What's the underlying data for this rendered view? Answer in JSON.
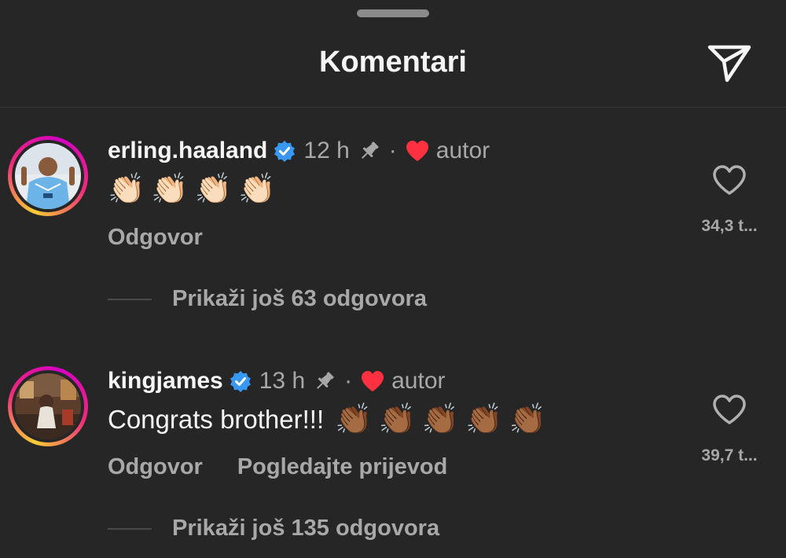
{
  "header": {
    "title": "Komentari",
    "share_icon": "send-icon"
  },
  "comments": [
    {
      "username": "erling.haaland",
      "verified": true,
      "time": "12 h",
      "pinned": true,
      "separator": "·",
      "author_liked": true,
      "author_label": "autor",
      "text": "",
      "emoji": [
        "👏🏻",
        "👏🏻",
        "👏🏻",
        "👏🏻"
      ],
      "reply_label": "Odgovor",
      "translate_label": "",
      "like_count": "34,3 t...",
      "view_replies": "Prikaži još 63 odgovora"
    },
    {
      "username": "kingjames",
      "verified": true,
      "time": "13 h",
      "pinned": true,
      "separator": "·",
      "author_liked": true,
      "author_label": "autor",
      "text": "Congrats brother!!!",
      "emoji": [
        "👏🏾",
        "👏🏾",
        "👏🏾",
        "👏🏾",
        "👏🏾"
      ],
      "reply_label": "Odgovor",
      "translate_label": "Pogledajte prijevod",
      "like_count": "39,7 t...",
      "view_replies": "Prikaži još 135 odgovora"
    }
  ],
  "colors": {
    "background": "#262626",
    "verified_blue": "#3897f0",
    "heart_red": "#ff3040",
    "secondary_text": "#a8a8a8"
  }
}
